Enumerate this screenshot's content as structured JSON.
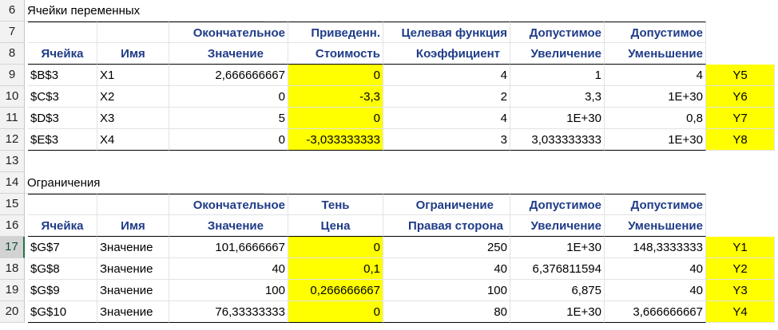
{
  "rows_numbers": [
    "6",
    "7",
    "8",
    "9",
    "10",
    "11",
    "12",
    "13",
    "14",
    "15",
    "16",
    "17",
    "18",
    "19",
    "20"
  ],
  "section1_title": "Ячейки переменных",
  "section2_title": "Ограничения",
  "var_headers": {
    "row7": [
      "",
      "",
      "Окончательное",
      "Приведенн.",
      "Целевая функция",
      "Допустимое",
      "Допустимое"
    ],
    "row8": [
      "Ячейка",
      "Имя",
      "Значение",
      "Стоимость",
      "Коэффициент",
      "Увеличение",
      "Уменьшение"
    ]
  },
  "var_rows": [
    {
      "cell": "$B$3",
      "name": "X1",
      "final": "2,666666667",
      "reduced": "0",
      "coef": "4",
      "inc": "1",
      "dec": "4",
      "label": "Y5"
    },
    {
      "cell": "$C$3",
      "name": "X2",
      "final": "0",
      "reduced": "-3,3",
      "coef": "2",
      "inc": "3,3",
      "dec": "1E+30",
      "label": "Y6"
    },
    {
      "cell": "$D$3",
      "name": "X3",
      "final": "5",
      "reduced": "0",
      "coef": "4",
      "inc": "1E+30",
      "dec": "0,8",
      "label": "Y7"
    },
    {
      "cell": "$E$3",
      "name": "X4",
      "final": "0",
      "reduced": "-3,033333333",
      "coef": "3",
      "inc": "3,033333333",
      "dec": "1E+30",
      "label": "Y8"
    }
  ],
  "con_headers": {
    "row15": [
      "",
      "",
      "Окончательное",
      "Тень",
      "Ограничение",
      "Допустимое",
      "Допустимое"
    ],
    "row16": [
      "Ячейка",
      "Имя",
      "Значение",
      "Цена",
      "Правая сторона",
      "Увеличение",
      "Уменьшение"
    ]
  },
  "con_rows": [
    {
      "cell": "$G$7",
      "name": "Значение",
      "final": "101,6666667",
      "shadow": "0",
      "rhs": "250",
      "inc": "1E+30",
      "dec": "148,3333333",
      "label": "Y1"
    },
    {
      "cell": "$G$8",
      "name": "Значение",
      "final": "40",
      "shadow": "0,1",
      "rhs": "40",
      "inc": "6,376811594",
      "dec": "40",
      "label": "Y2"
    },
    {
      "cell": "$G$9",
      "name": "Значение",
      "final": "100",
      "shadow": "0,266666667",
      "rhs": "100",
      "inc": "6,875",
      "dec": "40",
      "label": "Y3"
    },
    {
      "cell": "$G$10",
      "name": "Значение",
      "final": "76,33333333",
      "shadow": "0",
      "rhs": "80",
      "inc": "1E+30",
      "dec": "3,666666667",
      "label": "Y4"
    }
  ],
  "colors": {
    "header_text": "#1f3c88",
    "highlight": "#ffff00",
    "selected_row_border": "#217346"
  }
}
